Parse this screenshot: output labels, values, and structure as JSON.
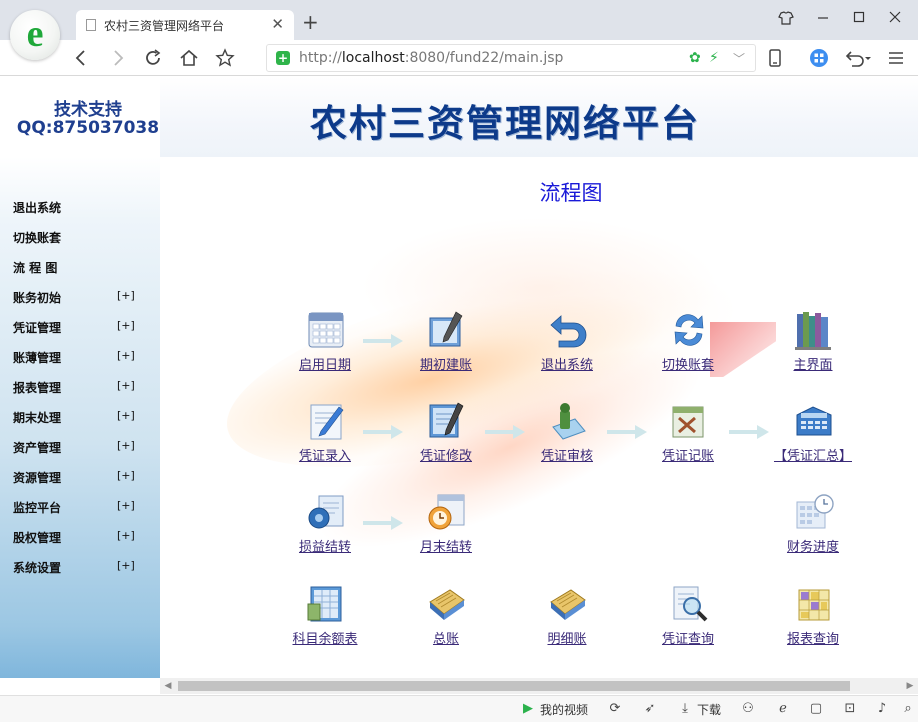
{
  "browser": {
    "tab_title": "农村三资管理网络平台",
    "url_prefix": "http://",
    "url_host": "localhost",
    "url_rest": ":8080/fund22/main.jsp",
    "new_tab_symbol": "+",
    "close_symbol": "✕"
  },
  "support": {
    "line1": "技术支持",
    "line2": "QQ:875037038"
  },
  "banner": {
    "title": "农村三资管理网络平台"
  },
  "sidebar": {
    "items": [
      {
        "label": "退出系统",
        "expander": ""
      },
      {
        "label": "切换账套",
        "expander": ""
      },
      {
        "label": "流 程 图",
        "expander": ""
      },
      {
        "label": "账务初始",
        "expander": "[+]"
      },
      {
        "label": "凭证管理",
        "expander": "[+]"
      },
      {
        "label": "账薄管理",
        "expander": "[+]"
      },
      {
        "label": "报表管理",
        "expander": "[+]"
      },
      {
        "label": "期末处理",
        "expander": "[+]"
      },
      {
        "label": "资产管理",
        "expander": "[+]"
      },
      {
        "label": "资源管理",
        "expander": "[+]"
      },
      {
        "label": "监控平台",
        "expander": "[+]"
      },
      {
        "label": "股权管理",
        "expander": "[+]"
      },
      {
        "label": "系统设置",
        "expander": "[+]"
      }
    ]
  },
  "flow": {
    "title": "流程图",
    "nodes": [
      {
        "label": "启用日期",
        "icon": "calendar-grid-icon"
      },
      {
        "label": "期初建账",
        "icon": "ledger-pen-icon"
      },
      {
        "label": "退出系统",
        "icon": "undo-arrow-icon"
      },
      {
        "label": "切换账套",
        "icon": "swap-arrows-icon"
      },
      {
        "label": "主界面",
        "icon": "books-icon"
      },
      {
        "label": "凭证录入",
        "icon": "document-edit-icon"
      },
      {
        "label": "凭证修改",
        "icon": "document-pen-icon"
      },
      {
        "label": "凭证审核",
        "icon": "audit-stamp-icon"
      },
      {
        "label": "凭证记账",
        "icon": "posting-tools-icon"
      },
      {
        "label": "【凭证汇总】",
        "icon": "calculator-icon"
      },
      {
        "label": "损益结转",
        "icon": "gear-document-icon"
      },
      {
        "label": "月末结转",
        "icon": "clock-calendar-icon"
      },
      {
        "label": "财务进度",
        "icon": "schedule-clock-icon"
      },
      {
        "label": "科目余额表",
        "icon": "spreadsheet-icon"
      },
      {
        "label": "总账",
        "icon": "ledger-book-icon"
      },
      {
        "label": "明细账",
        "icon": "ledger-book-icon"
      },
      {
        "label": "凭证查询",
        "icon": "magnifier-document-icon"
      },
      {
        "label": "报表查询",
        "icon": "report-grid-icon"
      }
    ]
  },
  "statusbar": {
    "video_label": "我的视频",
    "download_label": "下载"
  },
  "colors": {
    "sidebar_accent": "#7fb6dc",
    "title_blue": "#0d3a8a",
    "flow_title": "#1a1ad8",
    "link": "#3a2a78"
  }
}
